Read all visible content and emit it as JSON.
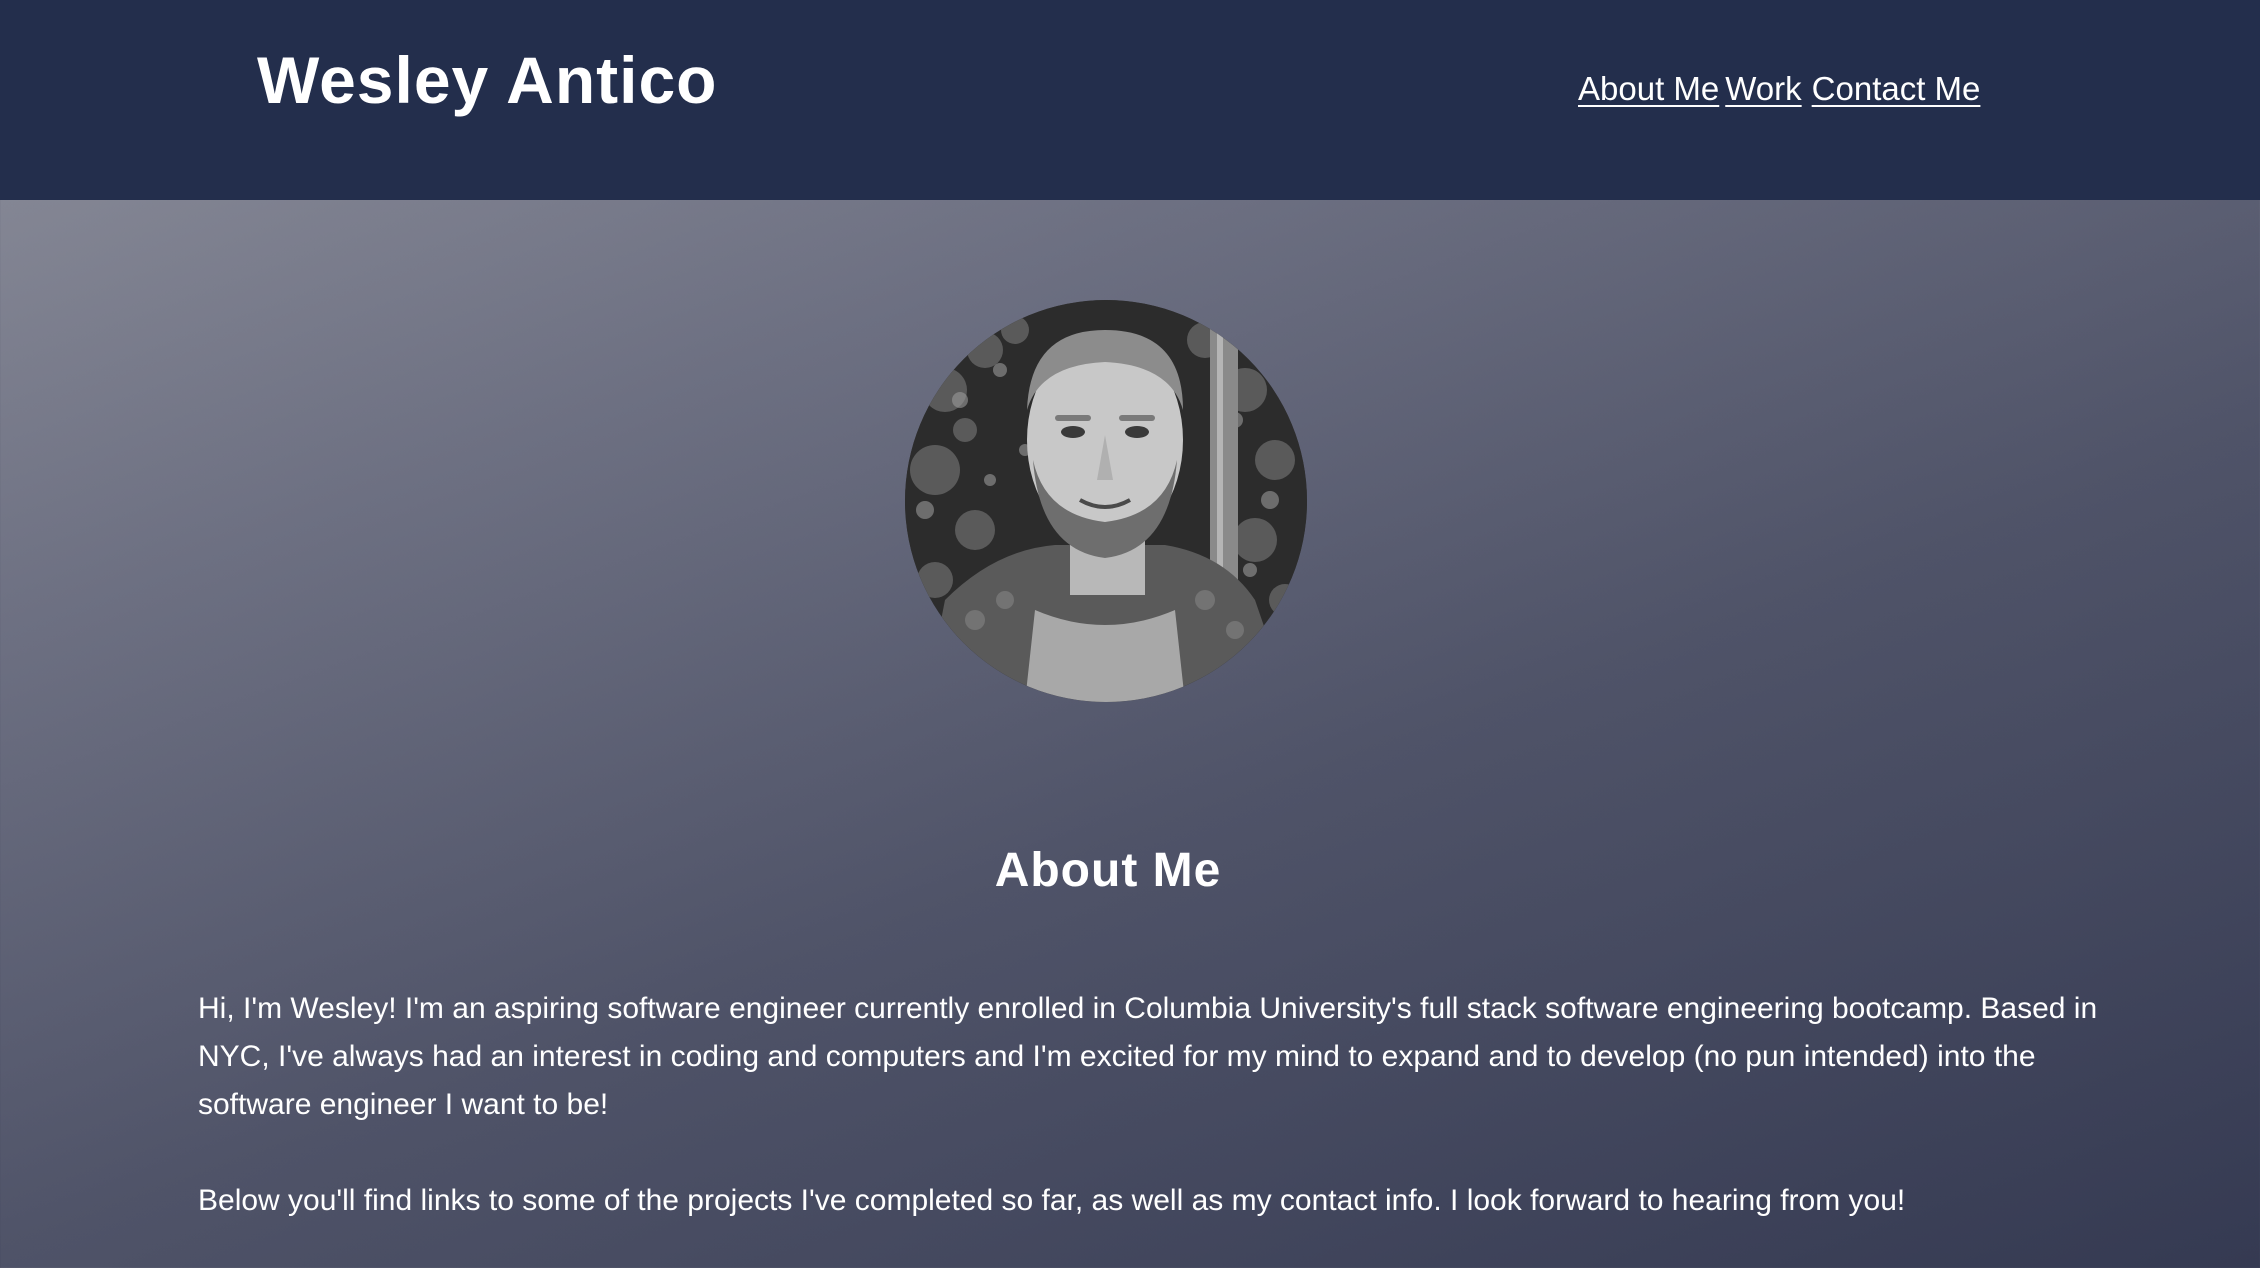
{
  "header": {
    "title": "Wesley Antico",
    "nav": [
      {
        "label": "About Me"
      },
      {
        "label": "Work"
      },
      {
        "label": "Contact Me"
      }
    ]
  },
  "about": {
    "heading": "About Me",
    "paragraphs": [
      "Hi, I'm Wesley! I'm an aspiring software engineer currently enrolled in Columbia University's full stack software engineering bootcamp. Based in NYC, I've always had an interest in coding and computers and I'm excited for my mind to expand and to develop (no pun intended) into the software engineer I want to be!",
      "Below you'll find links to some of the projects I've completed so far, as well as my contact info. I look forward to hearing from you!"
    ]
  },
  "colors": {
    "header_bg": "#232e4c",
    "text": "#ffffff",
    "gradient_start": "#8e909c",
    "gradient_end": "#353a52"
  }
}
